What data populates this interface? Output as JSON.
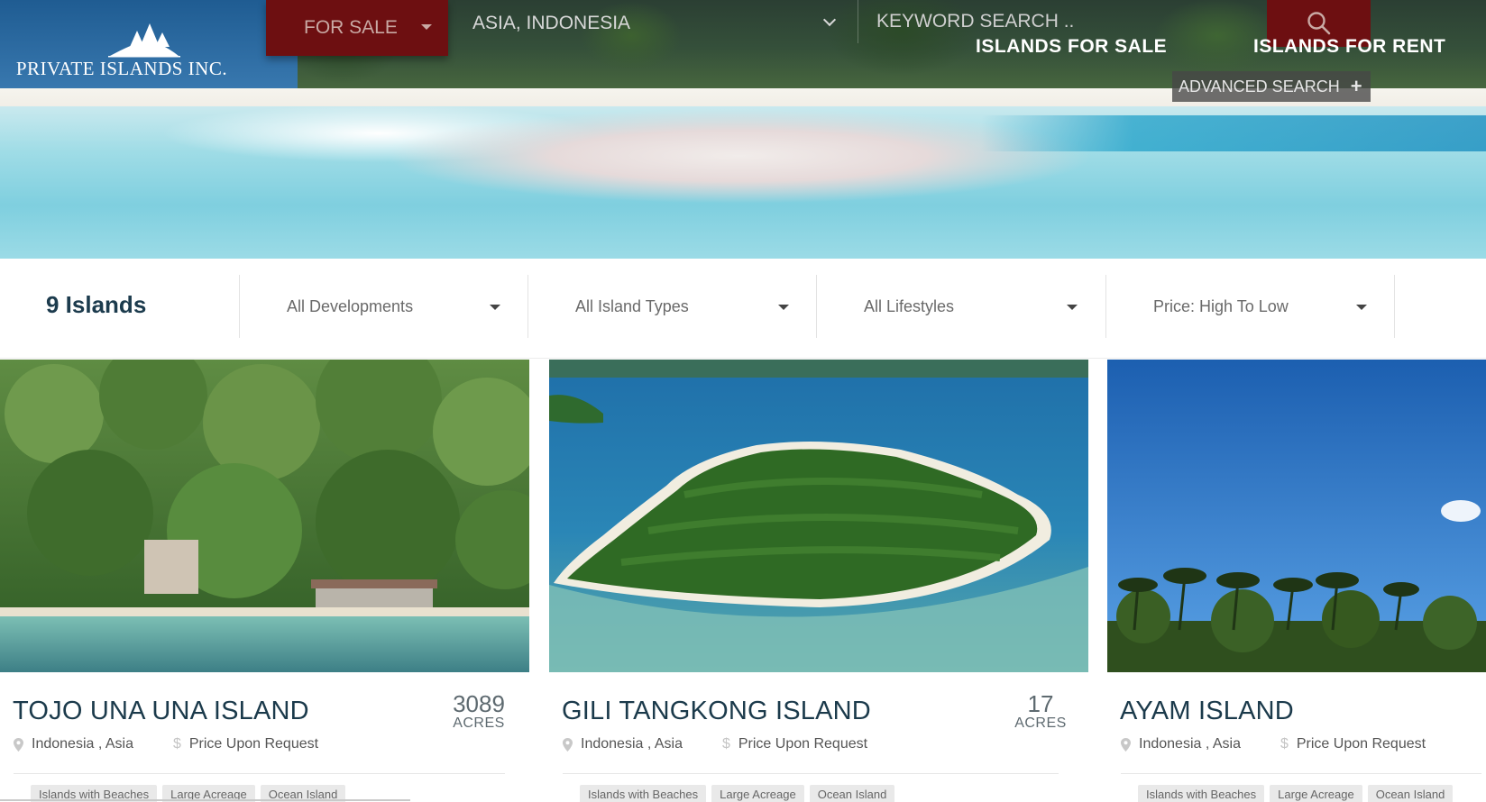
{
  "brand": {
    "name": "PRIVATE ISLANDS INC."
  },
  "search": {
    "type_value": "FOR SALE",
    "location_value": "ASIA, INDONESIA",
    "keyword_placeholder": "KEYWORD SEARCH .."
  },
  "nav": {
    "islands_for_sale": "ISLANDS FOR SALE",
    "islands_for_rent": "ISLANDS FOR RENT",
    "advanced_search": "ADVANCED SEARCH"
  },
  "filters": {
    "results_count": "9 Islands",
    "developments": "All Developments",
    "island_types": "All Island Types",
    "lifestyles": "All Lifestyles",
    "sort": "Price: High To Low"
  },
  "listings": [
    {
      "title": "TOJO UNA UNA ISLAND",
      "acres": "3089",
      "acres_unit": "ACRES",
      "location": "Indonesia , Asia",
      "price": "Price Upon Request",
      "tags": [
        "Islands with Beaches",
        "Large Acreage",
        "Ocean Island"
      ]
    },
    {
      "title": "GILI TANGKONG ISLAND",
      "acres": "17",
      "acres_unit": "ACRES",
      "location": "Indonesia , Asia",
      "price": "Price Upon Request",
      "tags": [
        "Islands with Beaches",
        "Large Acreage",
        "Ocean Island"
      ]
    },
    {
      "title": "AYAM ISLAND",
      "location": "Indonesia , Asia",
      "price": "Price Upon Request",
      "tags": [
        "Islands with Beaches",
        "Large Acreage",
        "Ocean Island"
      ]
    }
  ],
  "icons": {
    "search": "search-icon",
    "dropdown": "chevron-down-icon",
    "location": "map-pin-icon",
    "plus": "plus-icon"
  },
  "colors": {
    "accent": "#6d0f11",
    "title": "#1b3a4b"
  }
}
